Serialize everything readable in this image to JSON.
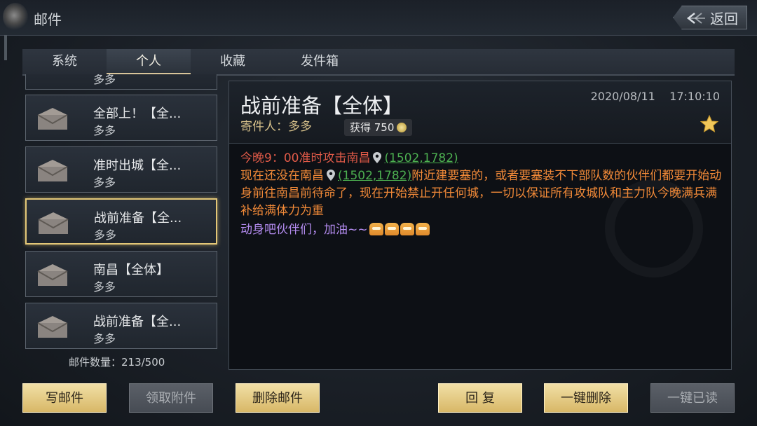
{
  "header": {
    "title": "邮件",
    "back_label": "返回"
  },
  "tabs": [
    {
      "label": "系统"
    },
    {
      "label": "个人",
      "active": true
    },
    {
      "label": "收藏"
    },
    {
      "label": "发件箱"
    }
  ],
  "mail_list": {
    "partial_top_sender": "多多",
    "items": [
      {
        "title": "全部上！【全...",
        "sender": "多多"
      },
      {
        "title": "准时出城【全...",
        "sender": "多多"
      },
      {
        "title": "战前准备【全...",
        "sender": "多多",
        "selected": true
      },
      {
        "title": "南昌【全体】",
        "sender": "多多"
      },
      {
        "title": "战前准备【全...",
        "sender": "多多"
      }
    ],
    "count_label": "邮件数量：213/500"
  },
  "detail": {
    "title": "战前准备【全体】",
    "sender_label": "寄件人：多多",
    "reward_label": "获得 750",
    "date": "2020/08/11",
    "time": "17:10:10",
    "line1_text": "今晚9：00准时攻击南昌",
    "coords": "(1502,1782)",
    "line2_prefix": "现在还没在南昌",
    "line2_suffix": "附近建要塞的，或者要塞装不下部队数的伙伴们都要开始动身前往南昌前待命了，现在开始禁止开任何城，一切以保证所有攻城队和主力队今晚满兵满补给满体力为重",
    "line3_text": "动身吧伙伴们，加油~~"
  },
  "buttons": {
    "write": "写邮件",
    "claim": "领取附件",
    "delete": "删除邮件",
    "reply": "回 复",
    "delete_all": "一键删除",
    "read_all": "一键已读"
  },
  "colors": {
    "gold_button": "#d8b867",
    "red_text": "#e05a48",
    "orange_text": "#f28a38",
    "link_green": "#4caf50",
    "purple_text": "#b48cf0"
  }
}
